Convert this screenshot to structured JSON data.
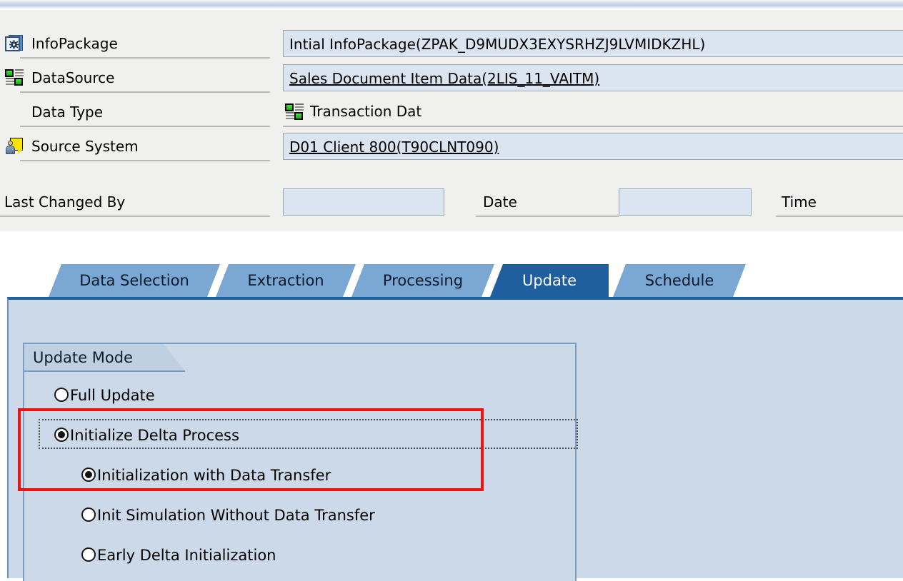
{
  "window": {
    "app": "SAP BW InfoPackage Maintenance"
  },
  "header": {
    "rows": [
      {
        "icon": "infopackage-icon",
        "label": "InfoPackage",
        "value": "Intial InfoPackage(ZPAK_D9MUDX3EXYSRHZJ9LVMIDKZHL)",
        "style": "input",
        "link": false
      },
      {
        "icon": "datasource-icon",
        "label": "DataSource",
        "value": "Sales Document Item Data(2LIS_11_VAITM)",
        "style": "input",
        "link": true
      },
      {
        "icon": "none",
        "label": "Data Type",
        "value": "Transaction Dat",
        "style": "plain",
        "link": false
      },
      {
        "icon": "source-system-icon",
        "label": "Source System",
        "value": "D01 Client 800(T90CLNT090)",
        "style": "input",
        "link": true
      }
    ],
    "changed_by_label": "Last Changed By",
    "changed_by_value": "",
    "date_label": "Date",
    "date_value": "",
    "time_label": "Time",
    "time_value": ""
  },
  "tabs": [
    {
      "label": "Data Selection",
      "active": false
    },
    {
      "label": "Extraction",
      "active": false
    },
    {
      "label": "Processing",
      "active": false
    },
    {
      "label": "Update",
      "active": true
    },
    {
      "label": "Schedule",
      "active": false
    }
  ],
  "update_panel": {
    "group_title": "Update Mode",
    "options": [
      {
        "label": "Full Update",
        "selected": false,
        "indent": 0
      },
      {
        "label": "Initialize Delta Process",
        "selected": true,
        "indent": 0
      },
      {
        "label": "Initialization with Data Transfer",
        "selected": true,
        "indent": 1
      },
      {
        "label": "Init Simulation Without Data Transfer",
        "selected": false,
        "indent": 1
      },
      {
        "label": "Early Delta Initialization",
        "selected": false,
        "indent": 1
      }
    ]
  },
  "annotation": {
    "highlight_color": "#ee1111"
  },
  "colors": {
    "tab_active": "#1f5fa0",
    "tab_inactive": "#7aa7d4",
    "panel_bg": "#ccd9e8",
    "field_bg": "#dbe5f1",
    "form_bg": "#f0f0ef"
  }
}
